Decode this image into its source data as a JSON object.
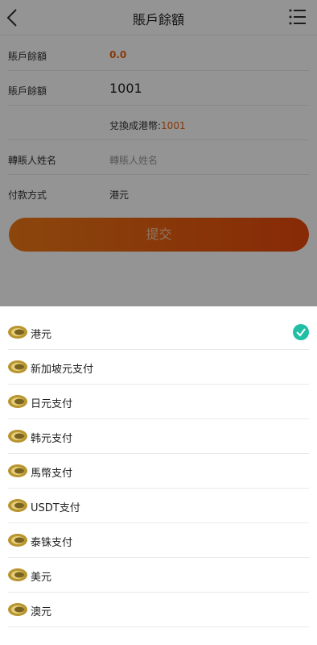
{
  "header": {
    "title": "賬戶餘額"
  },
  "form": {
    "balance_label": "賬戶餘額",
    "balance_value": "0.0",
    "amount_label": "賬戶餘額",
    "amount_value": "1001",
    "convert_prefix": "兌換成港幣:",
    "convert_value": "1001",
    "name_label": "轉賬人姓名",
    "name_placeholder": "轉賬人姓名",
    "pay_label": "付款方式",
    "pay_value": "港元"
  },
  "submit_label": "提交",
  "payment_options": [
    {
      "label": "港元",
      "selected": true
    },
    {
      "label": "新加坡元支付",
      "selected": false
    },
    {
      "label": "日元支付",
      "selected": false
    },
    {
      "label": "韩元支付",
      "selected": false
    },
    {
      "label": "馬幣支付",
      "selected": false
    },
    {
      "label": "USDT支付",
      "selected": false
    },
    {
      "label": "泰铢支付",
      "selected": false
    },
    {
      "label": "美元",
      "selected": false
    },
    {
      "label": "澳元",
      "selected": false
    }
  ],
  "colors": {
    "accent": "#e8620f",
    "check": "#1fbfa5",
    "overlay": "rgba(0,0,0,0.42)"
  }
}
